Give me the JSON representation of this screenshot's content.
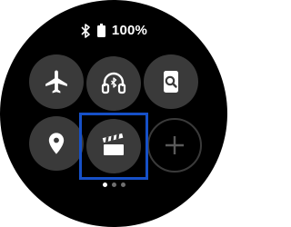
{
  "status_bar": {
    "bluetooth_icon": "bluetooth-icon",
    "battery_icon": "battery-full-icon",
    "battery_percent": "100%"
  },
  "quick_panel": {
    "tiles": [
      {
        "name": "airplane-mode",
        "icon": "airplane-icon",
        "state": "off"
      },
      {
        "name": "bluetooth-earbuds",
        "icon": "headphones-bluetooth-icon",
        "state": "off"
      },
      {
        "name": "find-my-phone",
        "icon": "phone-search-icon",
        "state": "off"
      },
      {
        "name": "location",
        "icon": "location-pin-icon",
        "state": "off"
      },
      {
        "name": "theater-mode",
        "icon": "clapperboard-icon",
        "state": "off",
        "focused": true
      },
      {
        "name": "add-tile",
        "icon": "plus-icon"
      }
    ]
  },
  "pagination": {
    "pages": 3,
    "current": 1
  },
  "colors": {
    "background": "#000000",
    "tile": "#3a3a3a",
    "icon": "#ffffff",
    "focus_highlight": "#1650c8",
    "add_outline": "#3a3a3a"
  }
}
